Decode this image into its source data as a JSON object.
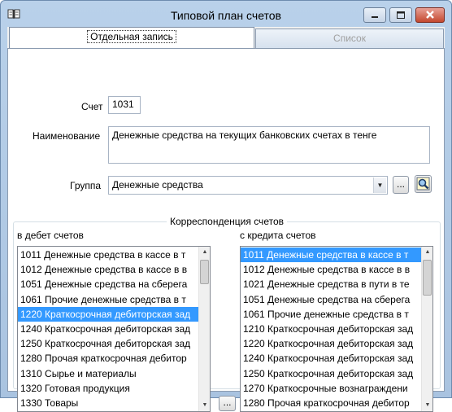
{
  "window": {
    "title": "Типовой план счетов"
  },
  "tabs": [
    {
      "label": "Отдельная запись"
    },
    {
      "label": "Список"
    }
  ],
  "form": {
    "account_label": "Счет",
    "account_value": "1031",
    "name_label": "Наименование",
    "name_value": "Денежные средства на текущих банковских счетах в тенге",
    "group_label": "Группа",
    "group_value": "Денежные средства",
    "ellipsis": "..."
  },
  "correspondence": {
    "title": "Корреспонденция счетов",
    "debit_label": "в дебет счетов",
    "credit_label": "с кредита счетов",
    "debit_items": [
      "1011 Денежные средства в кассе в т",
      "1012 Денежные средства в кассе в в",
      "1051 Денежные средства на сберега",
      "1061 Прочие денежные средства в т",
      "1220 Краткосрочная дебиторская зад",
      "1240 Краткосрочная дебиторская зад",
      "1250 Краткосрочная дебиторская зад",
      "1280 Прочая краткосрочная дебитор",
      "1310 Сырье и материалы",
      "1320 Готовая продукция",
      "1330 Товары"
    ],
    "debit_selected_index": 4,
    "credit_items": [
      "1011 Денежные средства в кассе в т",
      "1012 Денежные средства в кассе в в",
      "1021 Денежные средства в пути в те",
      "1051 Денежные средства на сберега",
      "1061 Прочие денежные средства в т",
      "1210 Краткосрочная дебиторская зад",
      "1220 Краткосрочная дебиторская зад",
      "1240 Краткосрочная дебиторская зад",
      "1250 Краткосрочная дебиторская зад",
      "1270 Краткосрочные вознаграждени",
      "1280 Прочая краткосрочная дебитор"
    ],
    "credit_selected_index": 0,
    "middle_button": "..."
  },
  "icons": {
    "app": "book-icon",
    "search": "magnifier-icon"
  }
}
